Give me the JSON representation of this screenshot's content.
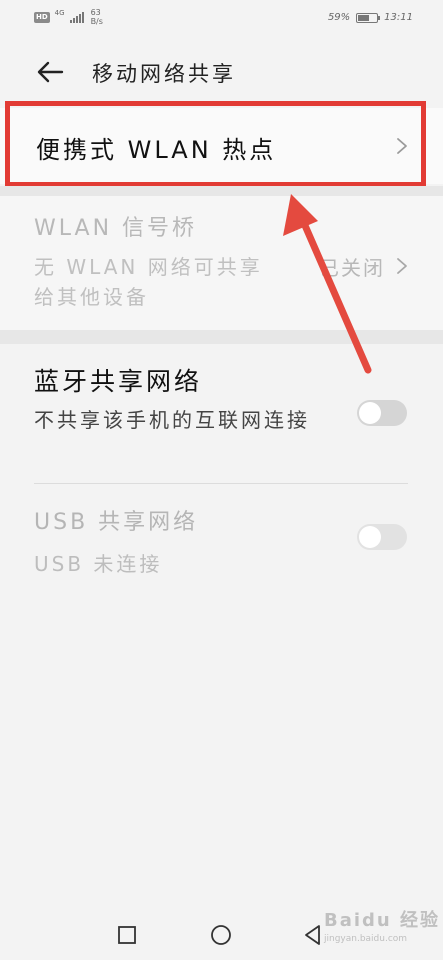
{
  "status_bar": {
    "hd_badge": "HD",
    "network_type": "4G",
    "net_speed_value": "63",
    "net_speed_unit": "B/s",
    "battery_percent": "59%",
    "battery_level": 0.59,
    "time": "13:11"
  },
  "header": {
    "title": "移动网络共享"
  },
  "items": {
    "hotspot": {
      "label": "便携式 WLAN 热点"
    },
    "bridge": {
      "title": "WLAN 信号桥",
      "description": "无 WLAN 网络可共享给其他设备",
      "status": "已关闭"
    },
    "bluetooth": {
      "title": "蓝牙共享网络",
      "description": "不共享该手机的互联网连接",
      "enabled": false
    },
    "usb": {
      "title": "USB 共享网络",
      "description": "USB 未连接",
      "enabled": false
    }
  },
  "watermark": {
    "logo": "Baidu 经验",
    "url": "jingyan.baidu.com"
  },
  "colors": {
    "highlight": "#e23b34",
    "background": "#f3f3f3"
  },
  "icons": [
    "back-arrow-icon",
    "chevron-right-icon",
    "nav-recents-icon",
    "nav-home-icon",
    "nav-back-icon"
  ]
}
